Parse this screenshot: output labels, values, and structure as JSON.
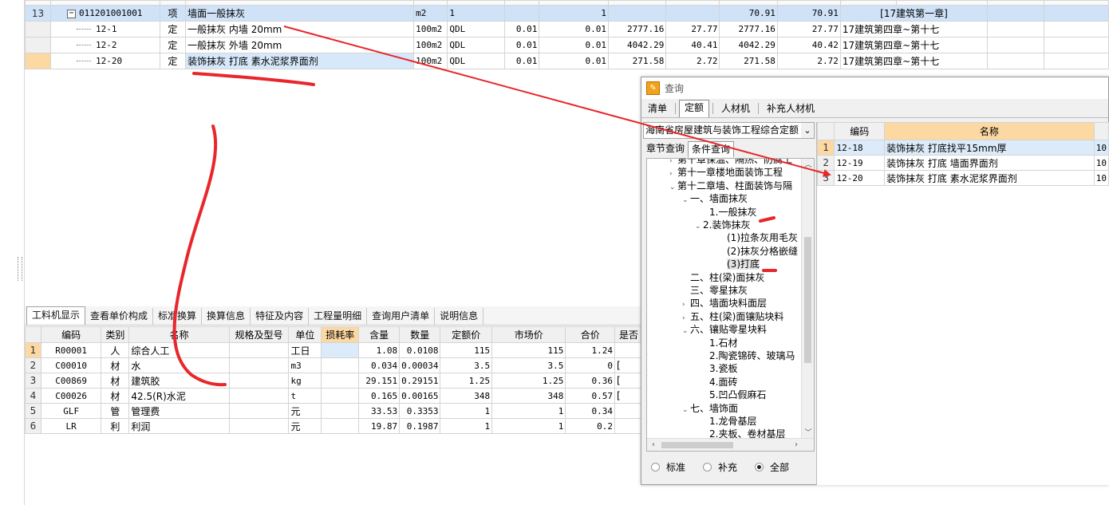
{
  "top_grid": {
    "rows": [
      {
        "idx": "13",
        "code": "011201001001",
        "kind": "项",
        "name": "墙面一般抹灰",
        "unit": "m2",
        "expr": "1",
        "c1": "",
        "c2": "1",
        "c3": "",
        "c4": "",
        "c5": "70.91",
        "c6": "70.91",
        "src": "[17建筑第一章]"
      },
      {
        "idx": "",
        "code": "12-1",
        "kind": "定",
        "name": "一般抹灰 内墙 20mm",
        "unit": "100m2",
        "expr": "QDL",
        "c1": "0.01",
        "c2": "0.01",
        "c3": "2777.16",
        "c4": "27.77",
        "c5": "2777.16",
        "c6": "27.77",
        "src": "17建筑第四章~第十七"
      },
      {
        "idx": "",
        "code": "12-2",
        "kind": "定",
        "name": "一般抹灰 外墙 20mm",
        "unit": "100m2",
        "expr": "QDL",
        "c1": "0.01",
        "c2": "0.01",
        "c3": "4042.29",
        "c4": "40.41",
        "c5": "4042.29",
        "c6": "40.42",
        "src": "17建筑第四章~第十七"
      },
      {
        "idx": "",
        "code": "12-20",
        "kind": "定",
        "name": "装饰抹灰 打底 素水泥浆界面剂",
        "unit": "100m2",
        "expr": "QDL",
        "c1": "0.01",
        "c2": "0.01",
        "c3": "271.58",
        "c4": "2.72",
        "c5": "271.58",
        "c6": "2.72",
        "src": "17建筑第四章~第十七"
      }
    ]
  },
  "bottom_panel": {
    "tabs": [
      "工料机显示",
      "查看单价构成",
      "标准换算",
      "换算信息",
      "特征及内容",
      "工程量明细",
      "查询用户清单",
      "说明信息"
    ],
    "columns": [
      "",
      "编码",
      "类别",
      "名称",
      "规格及型号",
      "单位",
      "损耗率",
      "含量",
      "数量",
      "定额价",
      "市场价",
      "合价",
      "是否"
    ],
    "rows": [
      {
        "idx": "1",
        "code": "R00001",
        "type": "人",
        "name": "综合人工",
        "spec": "",
        "unit": "工日",
        "loss": "",
        "qty": "1.08",
        "amount": "0.0108",
        "price": "115",
        "market": "115",
        "total": "1.24",
        "flag": ""
      },
      {
        "idx": "2",
        "code": "C00010",
        "type": "材",
        "name": "水",
        "spec": "",
        "unit": "m3",
        "loss": "",
        "qty": "0.034",
        "amount": "0.00034",
        "price": "3.5",
        "market": "3.5",
        "total": "0",
        "flag": "["
      },
      {
        "idx": "3",
        "code": "C00869",
        "type": "材",
        "name": "建筑胶",
        "spec": "",
        "unit": "kg",
        "loss": "",
        "qty": "29.151",
        "amount": "0.29151",
        "price": "1.25",
        "market": "1.25",
        "total": "0.36",
        "flag": "["
      },
      {
        "idx": "4",
        "code": "C00026",
        "type": "材",
        "name": "42.5(R)水泥",
        "spec": "",
        "unit": "t",
        "loss": "",
        "qty": "0.165",
        "amount": "0.00165",
        "price": "348",
        "market": "348",
        "total": "0.57",
        "flag": "["
      },
      {
        "idx": "5",
        "code": "GLF",
        "type": "管",
        "name": "管理费",
        "spec": "",
        "unit": "元",
        "loss": "",
        "qty": "33.53",
        "amount": "0.3353",
        "price": "1",
        "market": "1",
        "total": "0.34",
        "flag": ""
      },
      {
        "idx": "6",
        "code": "LR",
        "type": "利",
        "name": "利润",
        "spec": "",
        "unit": "元",
        "loss": "",
        "qty": "19.87",
        "amount": "0.1987",
        "price": "1",
        "market": "1",
        "total": "0.2",
        "flag": ""
      }
    ]
  },
  "dialog": {
    "title": "查询",
    "tabs": [
      "清单",
      "定额",
      "人材机",
      "补充人材机"
    ],
    "library": "海南省房屋建筑与装饰工程综合定额",
    "subtabs": [
      "章节查询",
      "条件查询"
    ],
    "tree": [
      {
        "label": "第十章保温、隔热、防腐工",
        "exp": "›"
      },
      {
        "label": "第十一章楼地面装饰工程",
        "exp": "›"
      },
      {
        "label": "第十二章墙、柱面装饰与隔",
        "exp": "⌄"
      },
      {
        "label": "一、墙面抹灰",
        "exp": "⌄"
      },
      {
        "label": "1.一般抹灰",
        "exp": ""
      },
      {
        "label": "2.装饰抹灰",
        "exp": "⌄"
      },
      {
        "label": "(1)拉条灰用毛灰",
        "exp": ""
      },
      {
        "label": "(2)抹灰分格嵌缝",
        "exp": ""
      },
      {
        "label": "(3)打底",
        "exp": ""
      },
      {
        "label": "二、柱(梁)面抹灰",
        "exp": ""
      },
      {
        "label": "三、零星抹灰",
        "exp": ""
      },
      {
        "label": "四、墙面块料面层",
        "exp": "›"
      },
      {
        "label": "五、柱(梁)面镶贴块料",
        "exp": "›"
      },
      {
        "label": "六、镶贴零星块料",
        "exp": "⌄"
      },
      {
        "label": "1.石材",
        "exp": ""
      },
      {
        "label": "2.陶瓷锦砖、玻璃马",
        "exp": ""
      },
      {
        "label": "3.瓷板",
        "exp": ""
      },
      {
        "label": "4.面砖",
        "exp": ""
      },
      {
        "label": "5.凹凸假麻石",
        "exp": ""
      },
      {
        "label": "七、墙饰面",
        "exp": "⌄"
      },
      {
        "label": "1.龙骨基层",
        "exp": ""
      },
      {
        "label": "2.夹板、卷材基层",
        "exp": ""
      }
    ],
    "radios": [
      {
        "label": "标准",
        "checked": false
      },
      {
        "label": "补充",
        "checked": false
      },
      {
        "label": "全部",
        "checked": true
      }
    ],
    "result_columns": [
      "",
      "编码",
      "名称",
      ""
    ],
    "results": [
      {
        "idx": "1",
        "code": "12-18",
        "name": "装饰抹灰 打底找平15mm厚",
        "unit": "10"
      },
      {
        "idx": "2",
        "code": "12-19",
        "name": "装饰抹灰 打底 墙面界面剂",
        "unit": "10"
      },
      {
        "idx": "3",
        "code": "12-20",
        "name": "装饰抹灰 打底 素水泥浆界面剂",
        "unit": "10"
      }
    ]
  },
  "colors": {
    "selection_blue": "#cfe2f8",
    "header_orange": "#fcd8a2",
    "annotation_red": "#e8262b"
  }
}
